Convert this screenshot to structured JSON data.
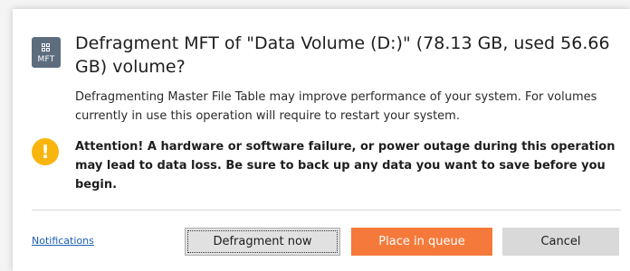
{
  "dialog": {
    "app_icon_label": "MFT",
    "title": "Defragment MFT of \"Data Volume (D:)\" (78.13 GB, used 56.66 GB) volume?",
    "description": "Defragmenting Master File Table may improve performance of your system. For volumes currently in use this operation will require to restart your system.",
    "warning": "Attention! A hardware or software failure, or power outage during this operation may lead to data loss. Be sure to back up any data you want to save before you begin.",
    "warning_icon_glyph": "!"
  },
  "footer": {
    "notifications_link": "Notifications",
    "defragment_now_label": "Defragment now",
    "place_in_queue_label": "Place in queue",
    "cancel_label": "Cancel"
  },
  "colors": {
    "accent_orange": "#f5793a",
    "warning_yellow": "#f8b50d",
    "app_icon_bg": "#5d6d7e",
    "link_blue": "#1a5fb4"
  },
  "icons": {
    "app": "mft-icon",
    "warning": "warning-icon"
  }
}
